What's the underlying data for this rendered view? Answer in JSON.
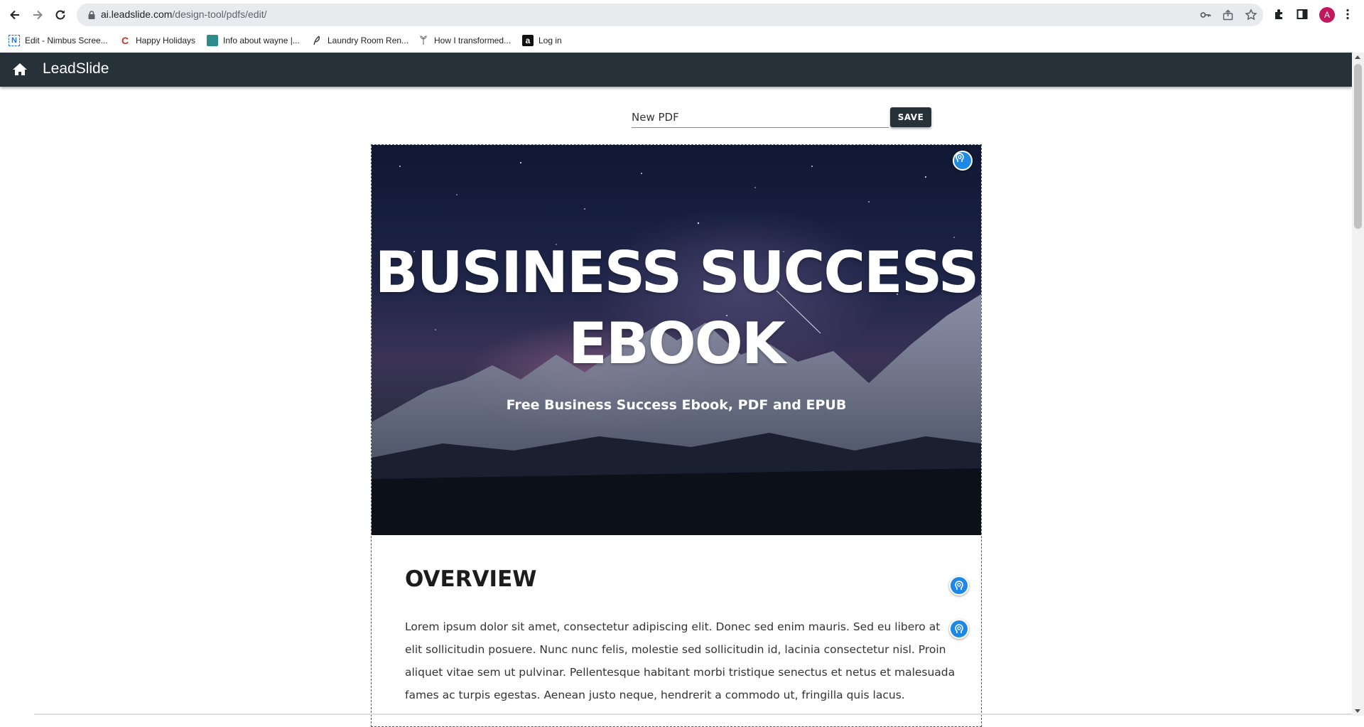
{
  "browser": {
    "url_domain": "ai.leadslide.com",
    "url_path": "/design-tool/pdfs/edit/",
    "profile_initial": "A",
    "bookmarks": [
      {
        "label": "Edit - Nimbus Scree...",
        "icon": "nimbus-icon",
        "glyph": "N"
      },
      {
        "label": "Happy Holidays",
        "icon": "c-logo-icon",
        "glyph": "C"
      },
      {
        "label": "Info about wayne |...",
        "icon": "site-icon",
        "glyph": ""
      },
      {
        "label": "Laundry Room Ren...",
        "icon": "leaf-icon",
        "glyph": ""
      },
      {
        "label": "How I transformed...",
        "icon": "plant-icon",
        "glyph": ""
      },
      {
        "label": "Log in",
        "icon": "amazon-icon",
        "glyph": "a"
      }
    ]
  },
  "app": {
    "brand": "LeadSlide",
    "nav_color": "#263238"
  },
  "editor": {
    "name_value": "New PDF",
    "save_label": "SAVE"
  },
  "document": {
    "hero_title": "BUSINESS SUCCESS EBOOK",
    "hero_subtitle": "Free Business Success Ebook, PDF and EPUB",
    "section_title": "OVERVIEW",
    "section_body": "Lorem ipsum dolor sit amet, consectetur adipiscing elit. Donec sed enim mauris. Sed eu libero at elit sollicitudin posuere. Nunc nunc felis, molestie sed sollicitudin id, lacinia consectetur nisl. Proin aliquet vitae sem ut pulvinar. Pellentesque habitant morbi tristique senectus et netus et malesuada fames ac turpis egestas. Aenean justo neque, hendrerit a commodo ut, fringilla quis lacus."
  },
  "colors": {
    "accent": "#1e88e5"
  }
}
